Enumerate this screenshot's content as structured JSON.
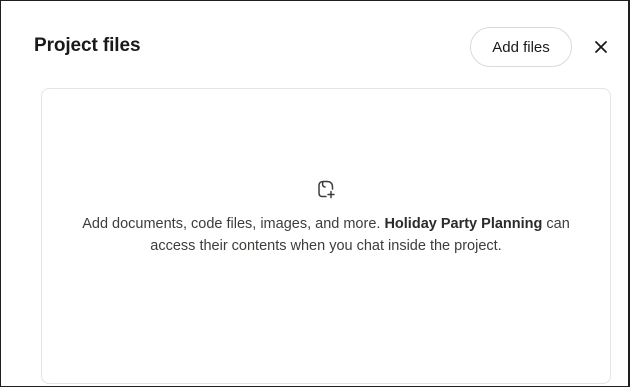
{
  "header": {
    "title": "Project files",
    "add_files_label": "Add files",
    "close_icon": "close-icon"
  },
  "dropzone": {
    "icon": "add-file-icon",
    "text_before": "Add documents, code files, images, and more. ",
    "project_name": "Holiday Party Planning",
    "text_after": " can access their contents when you chat inside the project."
  }
}
